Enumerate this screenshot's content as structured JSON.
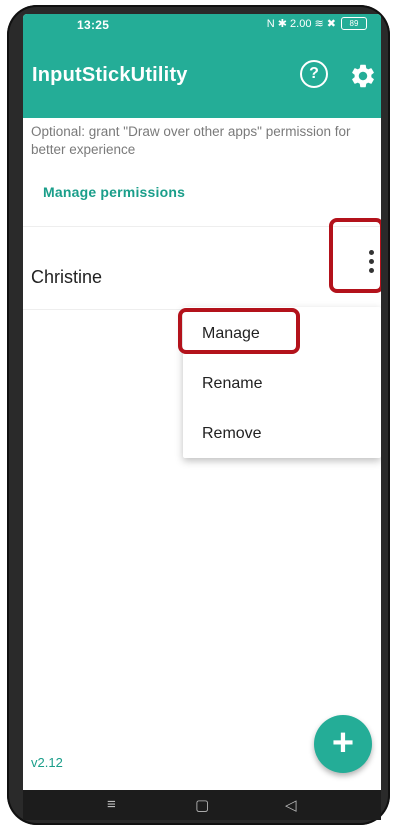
{
  "statusbar": {
    "time": "13:25",
    "icons": "N ✱ 2.00 ≋ ✖",
    "battery": "89"
  },
  "appbar": {
    "title": "InputStickUtility",
    "help_icon": "help-circle-icon",
    "settings_icon": "gear-icon",
    "help_glyph": "?"
  },
  "notice": {
    "text": "Optional: grant \"Draw over other apps\" permission for better experience",
    "link": "Manage permissions"
  },
  "devices": [
    {
      "name": "Christine"
    }
  ],
  "menu": {
    "items": [
      "Manage",
      "Rename",
      "Remove"
    ]
  },
  "footer": {
    "version": "v2.12",
    "fab_glyph": "+"
  },
  "navbar": {
    "menu_glyph": "≡",
    "home_glyph": "▢",
    "back_glyph": "◁"
  },
  "colors": {
    "accent": "#24ad97",
    "link": "#1a9e8a",
    "highlight": "#b3121b"
  }
}
